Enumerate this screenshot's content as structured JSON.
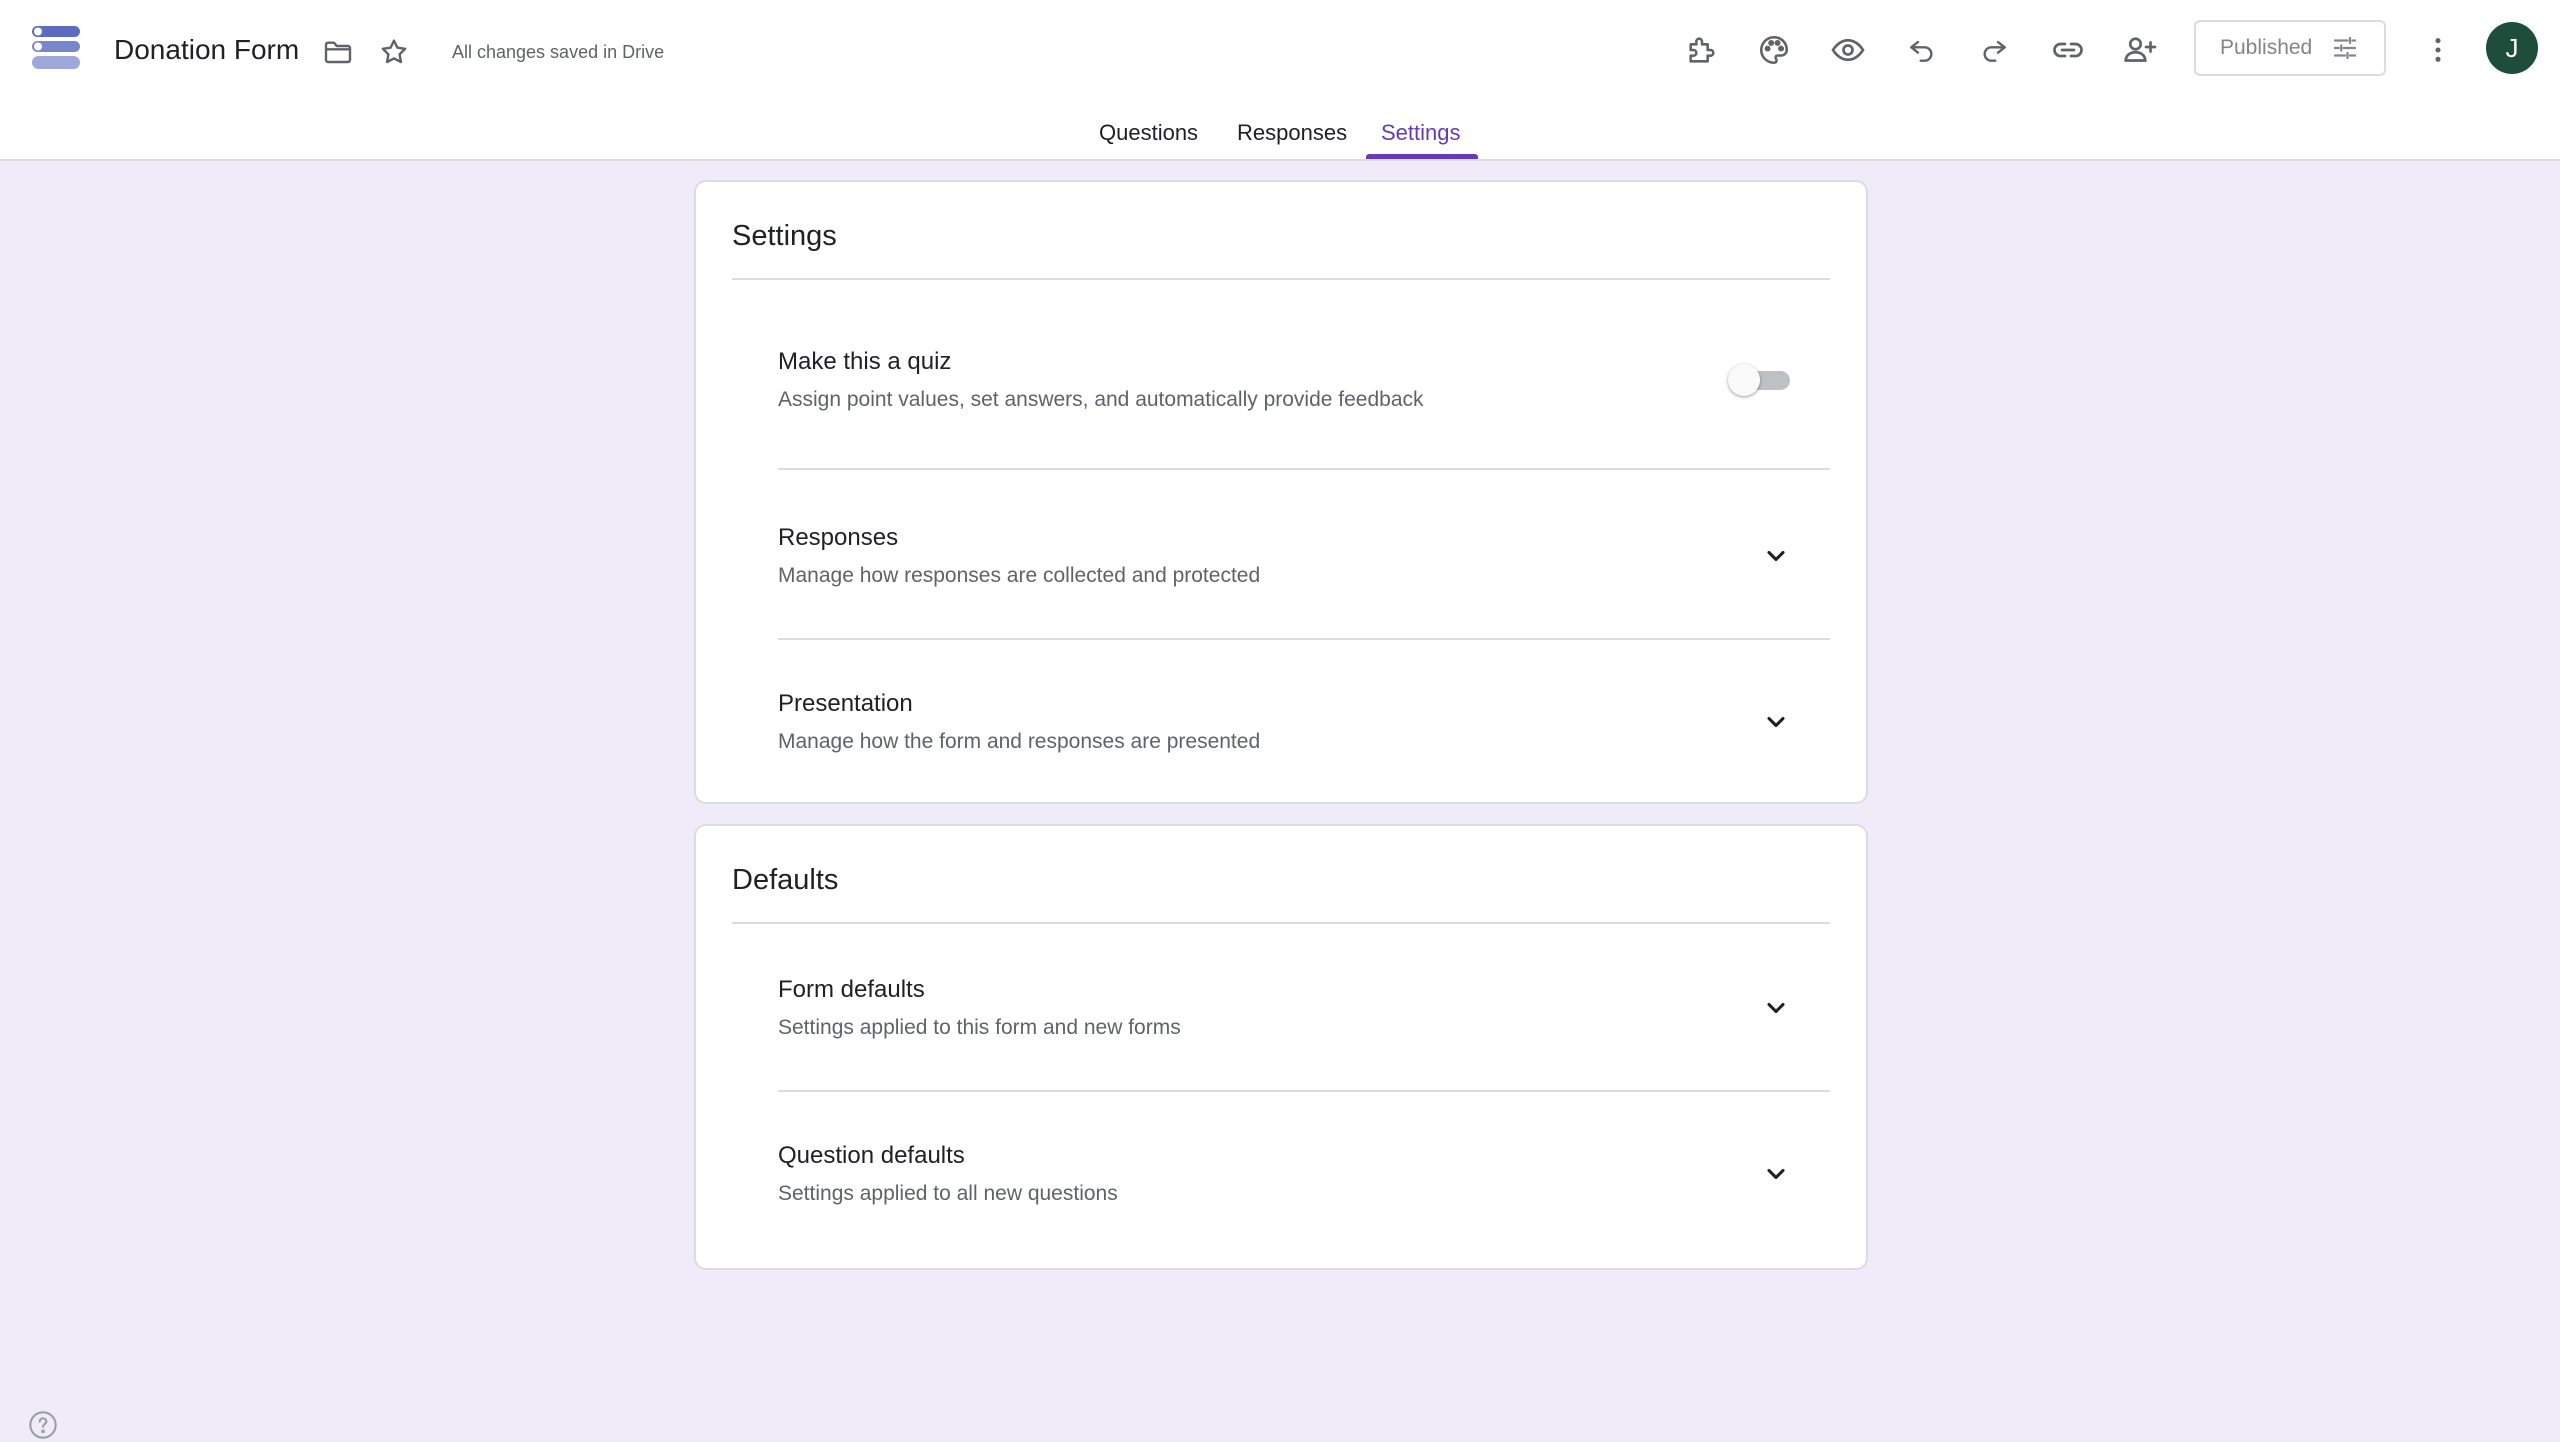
{
  "app": {
    "doc_title": "Donation Form",
    "save_status": "All changes saved in Drive",
    "publish_label": "Published",
    "avatar_initial": "J"
  },
  "icons": {
    "logo": "forms-logo-icon",
    "folder": "folder-icon",
    "star": "star-icon",
    "addons": "puzzle-icon",
    "theme": "palette-icon",
    "preview": "eye-icon",
    "undo": "undo-icon",
    "redo": "redo-icon",
    "link": "link-icon",
    "collaborators": "add-person-icon",
    "publish_options": "sliders-icon",
    "more": "more-vert-icon",
    "help": "help-icon",
    "expand": "chevron-down-icon"
  },
  "colors": {
    "accent": "#673ab7",
    "page_background": "#f0ebf8",
    "avatar_background": "#1e4d3a"
  },
  "tabs": [
    {
      "label": "Questions",
      "active": false
    },
    {
      "label": "Responses",
      "active": false
    },
    {
      "label": "Settings",
      "active": true
    }
  ],
  "settings_card": {
    "title": "Settings",
    "quiz": {
      "title": "Make this a quiz",
      "description": "Assign point values, set answers, and automatically provide feedback",
      "enabled": false
    },
    "responses": {
      "title": "Responses",
      "description": "Manage how responses are collected and protected"
    },
    "presentation": {
      "title": "Presentation",
      "description": "Manage how the form and responses are presented"
    }
  },
  "defaults_card": {
    "title": "Defaults",
    "form_defaults": {
      "title": "Form defaults",
      "description": "Settings applied to this form and new forms"
    },
    "question_defaults": {
      "title": "Question defaults",
      "description": "Settings applied to all new questions"
    }
  }
}
